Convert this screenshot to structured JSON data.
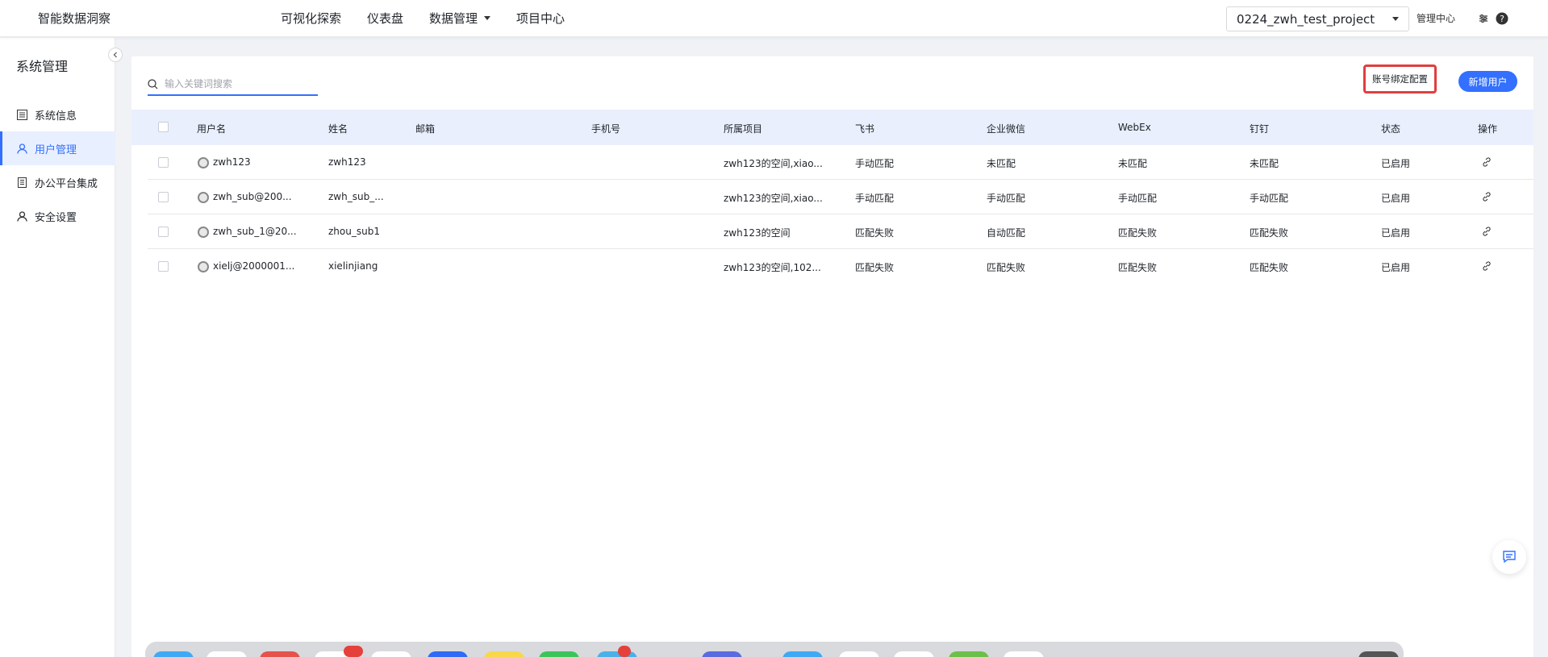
{
  "header": {
    "brand": "智能数据洞察",
    "nav": [
      {
        "label": "可视化探索"
      },
      {
        "label": "仪表盘"
      },
      {
        "label": "数据管理",
        "has_caret": true
      },
      {
        "label": "项目中心"
      }
    ],
    "project": "0224_zwh_test_project",
    "admin_link": "管理中心"
  },
  "sidebar": {
    "title": "系统管理",
    "items": [
      {
        "label": "系统信息",
        "icon": "list-icon",
        "active": false
      },
      {
        "label": "用户管理",
        "icon": "user-icon",
        "active": true
      },
      {
        "label": "办公平台集成",
        "icon": "document-icon",
        "active": false
      },
      {
        "label": "安全设置",
        "icon": "user-icon",
        "active": false
      }
    ]
  },
  "toolbar": {
    "search_placeholder": "输入关键词搜索",
    "bind_config_label": "账号绑定配置",
    "add_user_label": "新增用户"
  },
  "table": {
    "columns": [
      "用户名",
      "姓名",
      "邮箱",
      "手机号",
      "所属项目",
      "飞书",
      "企业微信",
      "WebEx",
      "钉钉",
      "状态",
      "操作"
    ],
    "rows": [
      {
        "username": "zwh123",
        "name": "zwh123",
        "email": "",
        "phone": "",
        "project": "zwh123的空间,xiao...",
        "feishu": "手动匹配",
        "wecom": "未匹配",
        "webex": "未匹配",
        "dingtalk": "未匹配",
        "status": "已启用"
      },
      {
        "username": "zwh_sub@200...",
        "name": "zwh_sub_...",
        "email": "",
        "phone": "",
        "project": "zwh123的空间,xiao...",
        "feishu": "手动匹配",
        "wecom": "手动匹配",
        "webex": "手动匹配",
        "dingtalk": "手动匹配",
        "status": "已启用"
      },
      {
        "username": "zwh_sub_1@20...",
        "name": "zhou_sub1",
        "email": "",
        "phone": "",
        "project": "zwh123的空间",
        "feishu": "匹配失败",
        "wecom": "自动匹配",
        "webex": "匹配失败",
        "dingtalk": "匹配失败",
        "status": "已启用"
      },
      {
        "username": "xielj@2000001...",
        "name": "xielinjiang",
        "email": "",
        "phone": "",
        "project": "zwh123的空间,102...",
        "feishu": "匹配失败",
        "wecom": "匹配失败",
        "webex": "匹配失败",
        "dingtalk": "匹配失败",
        "status": "已启用"
      }
    ]
  },
  "colors": {
    "primary": "#3370ff",
    "highlight_border": "#e03e3e",
    "table_header_bg": "#e9effc"
  }
}
